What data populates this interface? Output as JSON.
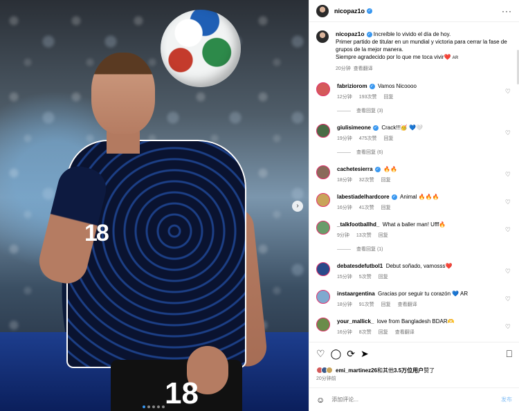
{
  "media": {
    "jersey_number": "18",
    "jersey_number_shorts": "18",
    "next_icon": "›",
    "carousel_dots": 5,
    "active_dot": 0
  },
  "header": {
    "username": "nicopaz1o",
    "verified_icon": "✓",
    "more_icon": "···"
  },
  "caption": {
    "username": "nicopaz1o",
    "verified_icon": "✓",
    "text1": "Increíble lo vivido el día de hoy.",
    "text2": "Primer partido de titular en un mundial y victoria para cerrar la fase de grupos de la mejor manera.",
    "text3": "Siempre agradecido por lo que me toca vivir",
    "heart": "❤️",
    "flag_text": "AR",
    "time": "20分钟",
    "translate": "查看翻译"
  },
  "comments": [
    {
      "user": "fabriziorom",
      "verified": true,
      "text": "Vamos Nicoooo",
      "time": "12分钟",
      "likes": "193次赞",
      "reply": "回复",
      "replies": "查看回复 (3)",
      "color": "#d45a5a"
    },
    {
      "user": "giulisimeone",
      "verified": true,
      "text": "Crack!!!🥳 💙🤍",
      "time": "19分钟",
      "likes": "475次赞",
      "reply": "回复",
      "replies": "查看回复 (6)",
      "color": "#4a6b45"
    },
    {
      "user": "cachetesierra",
      "verified": true,
      "text": "🔥🔥",
      "time": "18分钟",
      "likes": "32次赞",
      "reply": "回复",
      "replies": "",
      "color": "#8a6a5a"
    },
    {
      "user": "labestiadelhardcore",
      "verified": true,
      "text": "Animal 🔥🔥🔥",
      "time": "16分钟",
      "likes": "41次赞",
      "reply": "回复",
      "replies": "",
      "color": "#c9a45a"
    },
    {
      "user": "_talkfootballhd_",
      "verified": false,
      "text": "What a baller man! Ufff🔥",
      "time": "9分钟",
      "likes": "13次赞",
      "reply": "回复",
      "replies": "查看回复 (1)",
      "color": "#6a9c6a"
    },
    {
      "user": "debatesdefutbol1",
      "verified": false,
      "text": "Debut soñado, vamosss❤️",
      "time": "15分钟",
      "likes": "5次赞",
      "reply": "回复",
      "replies": "",
      "color": "#2a4a8a"
    },
    {
      "user": "instaargentina",
      "verified": false,
      "text": "Gracias por seguir tu corazón 💙 AR",
      "time": "18分钟",
      "likes": "91次赞",
      "reply": "回复",
      "translate": "查看翻译",
      "replies": "",
      "color": "#7fa9cf"
    },
    {
      "user": "your_mallick_",
      "verified": false,
      "text": "love from Bangladesh BDAR🫶",
      "time": "16分钟",
      "likes": "8次赞",
      "reply": "回复",
      "translate": "查看翻译",
      "replies": "",
      "color": "#6a8c4a"
    }
  ],
  "actions": {
    "like_icon": "♡",
    "comment_icon": "◯",
    "share_icon": "⟳",
    "send_icon": "➤",
    "save_icon": "⎕"
  },
  "likes": {
    "text_pre": "emi_martinez26",
    "text_mid": "和其他",
    "text_count": "3.5万位用户",
    "text_post": "赞了",
    "time": "20分钟前"
  },
  "add_comment": {
    "emoji_icon": "☺",
    "placeholder": "添加评论...",
    "post": "发布"
  }
}
